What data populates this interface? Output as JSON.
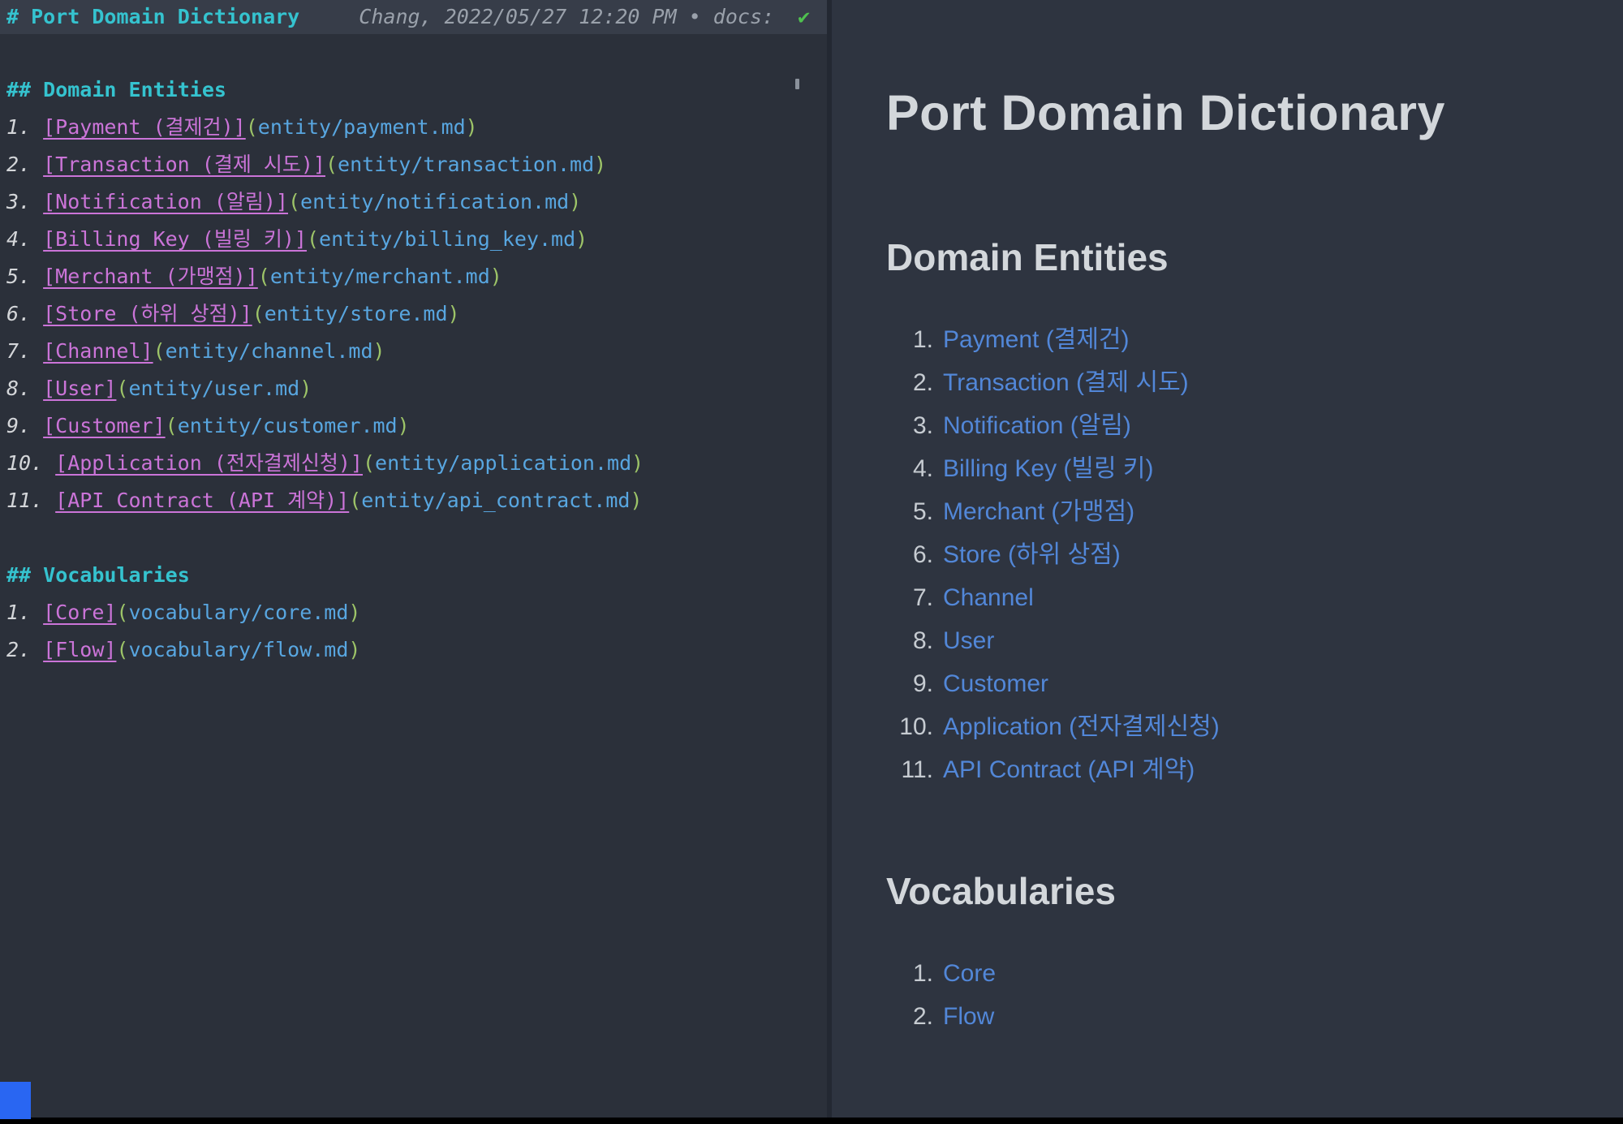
{
  "editor": {
    "title_line": {
      "heading": "# Port Domain Dictionary",
      "meta": "Chang, 2022/05/27 12:20 PM • docs:",
      "check": "✔",
      "trailing": "("
    },
    "syntax": {
      "open": "(",
      "close": ")"
    },
    "sections": [
      {
        "heading": "## Domain Entities",
        "items": [
          {
            "num": "1.",
            "link": "[Payment (결제건)]",
            "path": "entity/payment.md"
          },
          {
            "num": "2.",
            "link": "[Transaction (결제 시도)]",
            "path": "entity/transaction.md"
          },
          {
            "num": "3.",
            "link": "[Notification (알림)]",
            "path": "entity/notification.md"
          },
          {
            "num": "4.",
            "link": "[Billing Key (빌링 키)]",
            "path": "entity/billing_key.md"
          },
          {
            "num": "5.",
            "link": "[Merchant (가맹점)]",
            "path": "entity/merchant.md"
          },
          {
            "num": "6.",
            "link": "[Store (하위 상점)]",
            "path": "entity/store.md"
          },
          {
            "num": "7.",
            "link": "[Channel]",
            "path": "entity/channel.md"
          },
          {
            "num": "8.",
            "link": "[User]",
            "path": "entity/user.md"
          },
          {
            "num": "9.",
            "link": "[Customer]",
            "path": "entity/customer.md"
          },
          {
            "num": "10.",
            "link": "[Application (전자결제신청)]",
            "path": "entity/application.md"
          },
          {
            "num": "11.",
            "link": "[API Contract (API 계약)]",
            "path": "entity/api_contract.md"
          }
        ]
      },
      {
        "heading": "## Vocabularies",
        "items": [
          {
            "num": "1.",
            "link": "[Core]",
            "path": "vocabulary/core.md"
          },
          {
            "num": "2.",
            "link": "[Flow]",
            "path": "vocabulary/flow.md"
          }
        ]
      }
    ]
  },
  "preview": {
    "title": "Port Domain Dictionary",
    "sections": [
      {
        "heading": "Domain Entities",
        "items": [
          {
            "num": "1.",
            "label": "Payment (결제건)"
          },
          {
            "num": "2.",
            "label": "Transaction (결제 시도)"
          },
          {
            "num": "3.",
            "label": "Notification (알림)"
          },
          {
            "num": "4.",
            "label": "Billing Key (빌링 키)"
          },
          {
            "num": "5.",
            "label": "Merchant (가맹점)"
          },
          {
            "num": "6.",
            "label": "Store (하위 상점)"
          },
          {
            "num": "7.",
            "label": "Channel"
          },
          {
            "num": "8.",
            "label": "User"
          },
          {
            "num": "9.",
            "label": "Customer"
          },
          {
            "num": "10.",
            "label": "Application (전자결제신청)"
          },
          {
            "num": "11.",
            "label": "API Contract (API 계약)"
          }
        ]
      },
      {
        "heading": "Vocabularies",
        "items": [
          {
            "num": "1.",
            "label": "Core"
          },
          {
            "num": "2.",
            "label": "Flow"
          }
        ]
      }
    ]
  },
  "colors": {
    "editor_bg": "#2b303a",
    "preview_bg": "#2e3440",
    "heading_cyan": "#35c3cf",
    "link_magenta": "#cb74d8",
    "paren_green": "#9dc468",
    "path_blue": "#58a6e0",
    "preview_link_blue": "#5287d8",
    "check_green": "#4fc14f",
    "corner_blue": "#2966f2"
  }
}
